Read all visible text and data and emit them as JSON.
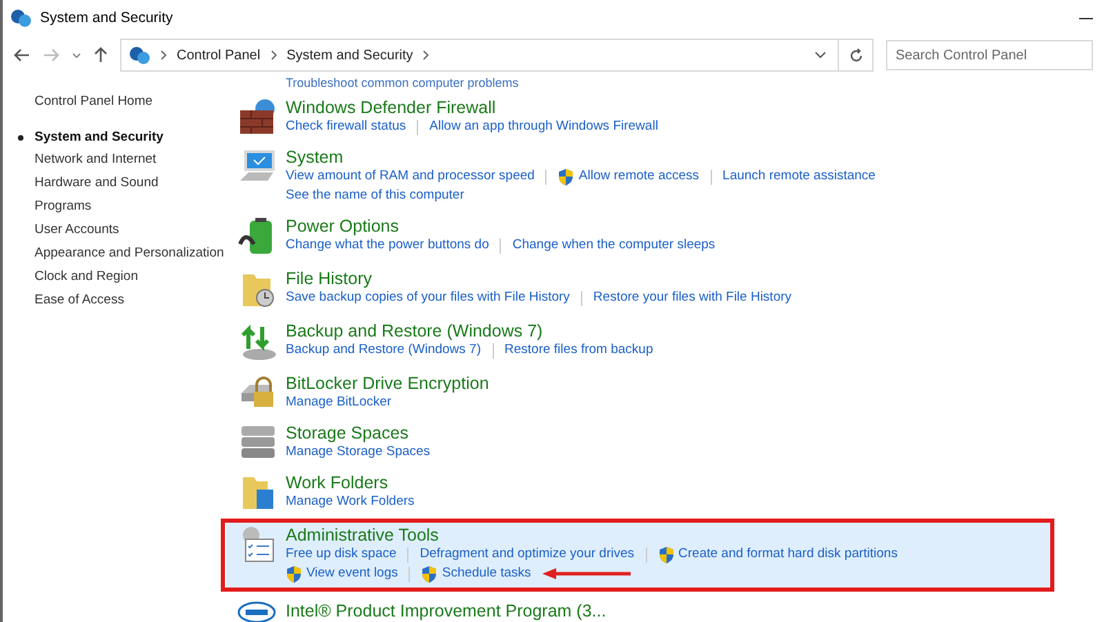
{
  "window": {
    "title": "System and Security"
  },
  "address_bar": {
    "breadcrumbs": [
      "Control Panel",
      "System and Security"
    ]
  },
  "search": {
    "placeholder": "Search Control Panel"
  },
  "sidebar": {
    "home": "Control Panel Home",
    "items": [
      {
        "label": "System and Security",
        "selected": true
      },
      {
        "label": "Network and Internet",
        "selected": false
      },
      {
        "label": "Hardware and Sound",
        "selected": false
      },
      {
        "label": "Programs",
        "selected": false
      },
      {
        "label": "User Accounts",
        "selected": false
      },
      {
        "label": "Appearance and Personalization",
        "selected": false
      },
      {
        "label": "Clock and Region",
        "selected": false
      },
      {
        "label": "Ease of Access",
        "selected": false
      }
    ]
  },
  "top_link": "Troubleshoot common computer problems",
  "sections": [
    {
      "kind": "firewall",
      "title": "Windows Defender Firewall",
      "highlighted": false,
      "link_rows": [
        [
          {
            "label": "Check firewall status",
            "shield": false
          },
          {
            "label": "Allow an app through Windows Firewall",
            "shield": false
          }
        ]
      ]
    },
    {
      "kind": "system",
      "title": "System",
      "highlighted": false,
      "link_rows": [
        [
          {
            "label": "View amount of RAM and processor speed",
            "shield": false
          },
          {
            "label": "Allow remote access",
            "shield": true
          },
          {
            "label": "Launch remote assistance",
            "shield": false
          }
        ],
        [
          {
            "label": "See the name of this computer",
            "shield": false
          }
        ]
      ]
    },
    {
      "kind": "power",
      "title": "Power Options",
      "highlighted": false,
      "link_rows": [
        [
          {
            "label": "Change what the power buttons do",
            "shield": false
          },
          {
            "label": "Change when the computer sleeps",
            "shield": false
          }
        ]
      ]
    },
    {
      "kind": "file-history",
      "title": "File History",
      "highlighted": false,
      "link_rows": [
        [
          {
            "label": "Save backup copies of your files with File History",
            "shield": false
          },
          {
            "label": "Restore your files with File History",
            "shield": false
          }
        ]
      ]
    },
    {
      "kind": "backup",
      "title": "Backup and Restore (Windows 7)",
      "highlighted": false,
      "link_rows": [
        [
          {
            "label": "Backup and Restore (Windows 7)",
            "shield": false
          },
          {
            "label": "Restore files from backup",
            "shield": false
          }
        ]
      ]
    },
    {
      "kind": "bitlocker",
      "title": "BitLocker Drive Encryption",
      "highlighted": false,
      "link_rows": [
        [
          {
            "label": "Manage BitLocker",
            "shield": false
          }
        ]
      ]
    },
    {
      "kind": "storage",
      "title": "Storage Spaces",
      "highlighted": false,
      "link_rows": [
        [
          {
            "label": "Manage Storage Spaces",
            "shield": false
          }
        ]
      ]
    },
    {
      "kind": "work-folders",
      "title": "Work Folders",
      "highlighted": false,
      "link_rows": [
        [
          {
            "label": "Manage Work Folders",
            "shield": false
          }
        ]
      ]
    },
    {
      "kind": "admin",
      "title": "Administrative Tools",
      "highlighted": true,
      "link_rows": [
        [
          {
            "label": "Free up disk space",
            "shield": false
          },
          {
            "label": "Defragment and optimize your drives",
            "shield": false
          },
          {
            "label": "Create and format hard disk partitions",
            "shield": true
          }
        ],
        [
          {
            "label": "View event logs",
            "shield": true
          },
          {
            "label": "Schedule tasks",
            "shield": true
          }
        ]
      ]
    },
    {
      "kind": "intel",
      "title": "Intel® Product Improvement Program (3...",
      "highlighted": false
    }
  ]
}
